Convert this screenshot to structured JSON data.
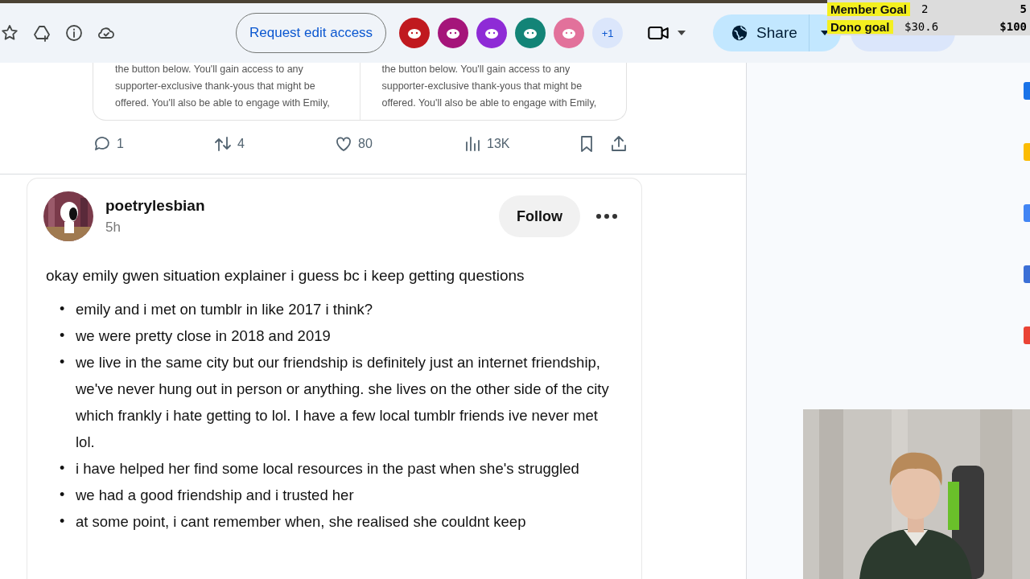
{
  "toolbar": {
    "request_button": "Request edit access",
    "collaborators": [
      {
        "color": "#c0191f"
      },
      {
        "color": "#a5157a"
      },
      {
        "color": "#8e2bd6"
      },
      {
        "color": "#138477"
      },
      {
        "color": "#e2719b"
      }
    ],
    "more_count": "+1",
    "share_label": "Share"
  },
  "goal_overlay": [
    {
      "label": "Member Goal",
      "current": "2",
      "target": "5"
    },
    {
      "label": "Dono goal",
      "current": "$30.6",
      "target": "$100"
    }
  ],
  "previous_post": {
    "cards": [
      {
        "lines": [
          "the button below. You'll gain access to any",
          "supporter-exclusive thank-yous that might be",
          "offered. You'll also be able to engage with Emily,"
        ]
      },
      {
        "lines": [
          "the button below. You'll gain access to any",
          "supporter-exclusive thank-yous that might be",
          "offered. You'll also be able to engage with Emily,"
        ]
      }
    ],
    "replies": "1",
    "reposts": "4",
    "likes": "80",
    "views": "13K"
  },
  "post": {
    "username": "poetrylesbian",
    "time": "5h",
    "follow_button": "Follow",
    "intro": "okay emily gwen situation explainer i guess bc i keep getting questions",
    "bullet_marker": "•",
    "bullets": [
      "emily and i met on tumblr in like 2017 i think?",
      "we were pretty close in 2018 and 2019",
      "we live in the same city but our friendship is definitely just an internet friendship, we've never hung out in person or anything. she lives on the other side of the city which frankly i hate getting to lol. I have a few local tumblr friends ive never met lol.",
      "i have helped her find some local resources in the past when she's struggled",
      "we had a good friendship and i trusted her",
      "at some point, i cant remember when, she realised she couldnt keep"
    ]
  }
}
